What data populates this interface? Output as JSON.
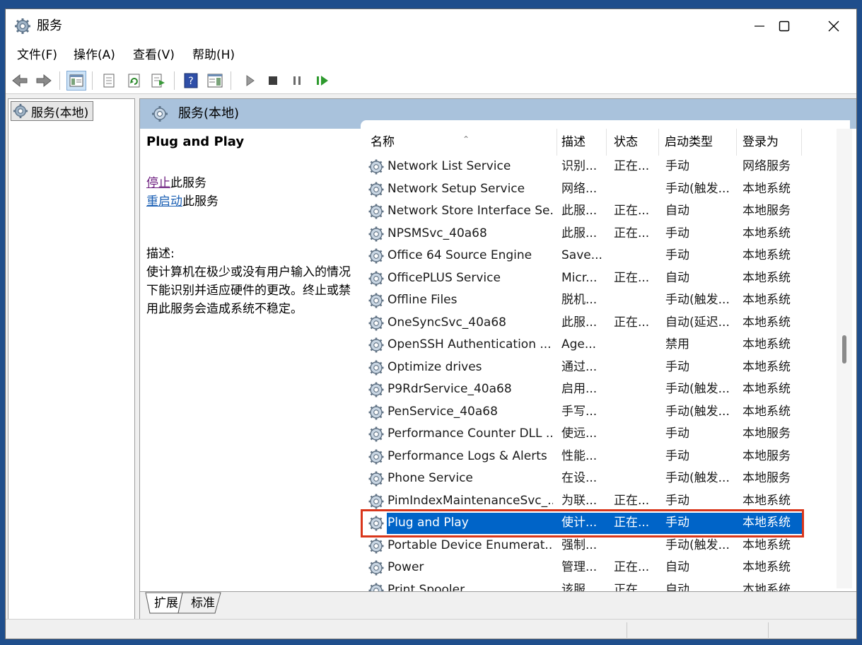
{
  "window": {
    "title": "服务"
  },
  "menu": {
    "items": [
      "文件(F)",
      "操作(A)",
      "查看(V)",
      "帮助(H)"
    ]
  },
  "tree": {
    "item_label": "服务(本地)"
  },
  "pane": {
    "header_title": "服务(本地)"
  },
  "details": {
    "service_name": "Plug and Play",
    "stop_link": "停止",
    "stop_suffix": "此服务",
    "restart_link": "重启动",
    "restart_suffix": "此服务",
    "description_label": "描述:",
    "description_text": "使计算机在极少或没有用户输入的情况下能识别并适应硬件的更改。终止或禁用此服务会造成系统不稳定。"
  },
  "columns": [
    "名称",
    "描述",
    "状态",
    "启动类型",
    "登录为"
  ],
  "services": [
    {
      "name": "Network List Service",
      "desc": "识别...",
      "status": "正在...",
      "startup": "手动",
      "logon": "网络服务"
    },
    {
      "name": "Network Setup Service",
      "desc": "网络...",
      "status": "",
      "startup": "手动(触发...",
      "logon": "本地系统"
    },
    {
      "name": "Network Store Interface Se...",
      "desc": "此服...",
      "status": "正在...",
      "startup": "自动",
      "logon": "本地服务"
    },
    {
      "name": "NPSMSvc_40a68",
      "desc": "此服...",
      "status": "正在...",
      "startup": "手动",
      "logon": "本地系统"
    },
    {
      "name": "Office 64 Source Engine",
      "desc": "Save...",
      "status": "",
      "startup": "手动",
      "logon": "本地系统"
    },
    {
      "name": "OfficePLUS Service",
      "desc": "Micr...",
      "status": "正在...",
      "startup": "自动",
      "logon": "本地系统"
    },
    {
      "name": "Offline Files",
      "desc": "脱机...",
      "status": "",
      "startup": "手动(触发...",
      "logon": "本地系统"
    },
    {
      "name": "OneSyncSvc_40a68",
      "desc": "此服...",
      "status": "正在...",
      "startup": "自动(延迟...",
      "logon": "本地系统"
    },
    {
      "name": "OpenSSH Authentication ...",
      "desc": "Age...",
      "status": "",
      "startup": "禁用",
      "logon": "本地系统"
    },
    {
      "name": "Optimize drives",
      "desc": "通过...",
      "status": "",
      "startup": "手动",
      "logon": "本地系统"
    },
    {
      "name": "P9RdrService_40a68",
      "desc": "启用...",
      "status": "",
      "startup": "手动(触发...",
      "logon": "本地系统"
    },
    {
      "name": "PenService_40a68",
      "desc": "手写...",
      "status": "",
      "startup": "手动(触发...",
      "logon": "本地系统"
    },
    {
      "name": "Performance Counter DLL ...",
      "desc": "使远...",
      "status": "",
      "startup": "手动",
      "logon": "本地服务"
    },
    {
      "name": "Performance Logs & Alerts",
      "desc": "性能...",
      "status": "",
      "startup": "手动",
      "logon": "本地服务"
    },
    {
      "name": "Phone Service",
      "desc": "在设...",
      "status": "",
      "startup": "手动(触发...",
      "logon": "本地服务"
    },
    {
      "name": "PimIndexMaintenanceSvc_...",
      "desc": "为联...",
      "status": "正在...",
      "startup": "手动",
      "logon": "本地系统"
    },
    {
      "name": "Plug and Play",
      "desc": "使计...",
      "status": "正在...",
      "startup": "手动",
      "logon": "本地系统",
      "selected": true
    },
    {
      "name": "Portable Device Enumerat...",
      "desc": "强制...",
      "status": "",
      "startup": "手动(触发...",
      "logon": "本地系统"
    },
    {
      "name": "Power",
      "desc": "管理...",
      "status": "正在...",
      "startup": "自动",
      "logon": "本地系统"
    },
    {
      "name": "Print Spooler",
      "desc": "该服...",
      "status": "正在...",
      "startup": "自动",
      "logon": "本地系统"
    }
  ],
  "tabs": [
    "扩展",
    "标准"
  ],
  "colors": {
    "selection": "#0064c8",
    "highlight_border": "#d9361b",
    "pane_header": "#a9c2dc"
  }
}
